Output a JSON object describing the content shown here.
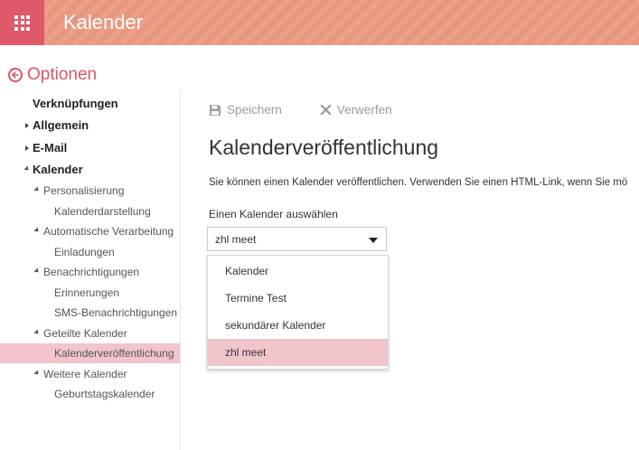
{
  "app": {
    "title": "Kalender"
  },
  "options": {
    "label": "Optionen"
  },
  "nav": {
    "items": [
      {
        "label": "Verknüpfungen",
        "level": 1,
        "arrow": "none"
      },
      {
        "label": "Allgemein",
        "level": 1,
        "arrow": "right"
      },
      {
        "label": "E-Mail",
        "level": 1,
        "arrow": "right"
      },
      {
        "label": "Kalender",
        "level": 1,
        "arrow": "down"
      },
      {
        "label": "Personalisierung",
        "level": 2,
        "arrow": "down"
      },
      {
        "label": "Kalenderdarstellung",
        "level": 3,
        "arrow": "none"
      },
      {
        "label": "Automatische Verarbeitung",
        "level": 2,
        "arrow": "down"
      },
      {
        "label": "Einladungen",
        "level": 3,
        "arrow": "none"
      },
      {
        "label": "Benachrichtigungen",
        "level": 2,
        "arrow": "down"
      },
      {
        "label": "Erinnerungen",
        "level": 3,
        "arrow": "none"
      },
      {
        "label": "SMS-Benachrichtigungen",
        "level": 3,
        "arrow": "none"
      },
      {
        "label": "Geteilte Kalender",
        "level": 2,
        "arrow": "down"
      },
      {
        "label": "Kalenderveröffentlichung",
        "level": 3,
        "arrow": "none",
        "selected": true
      },
      {
        "label": "Weitere Kalender",
        "level": 2,
        "arrow": "down"
      },
      {
        "label": "Geburtstagskalender",
        "level": 3,
        "arrow": "none"
      }
    ]
  },
  "toolbar": {
    "save_label": "Speichern",
    "discard_label": "Verwerfen"
  },
  "main": {
    "title": "Kalenderveröffentlichung",
    "description": "Sie können einen Kalender veröffentlichen. Verwenden Sie einen HTML-Link, wenn Sie mö",
    "select_label": "Einen Kalender auswählen",
    "selected_value": "zhl meet"
  },
  "dropdown": {
    "options": [
      "Kalender",
      "Termine Test",
      "sekundärer Kalender",
      "zhl meet"
    ],
    "selected_index": 3
  },
  "colors": {
    "accent": "#d9546a",
    "header": "#e9967f",
    "waffle": "#e0596a",
    "selection": "#f2c4cc"
  }
}
